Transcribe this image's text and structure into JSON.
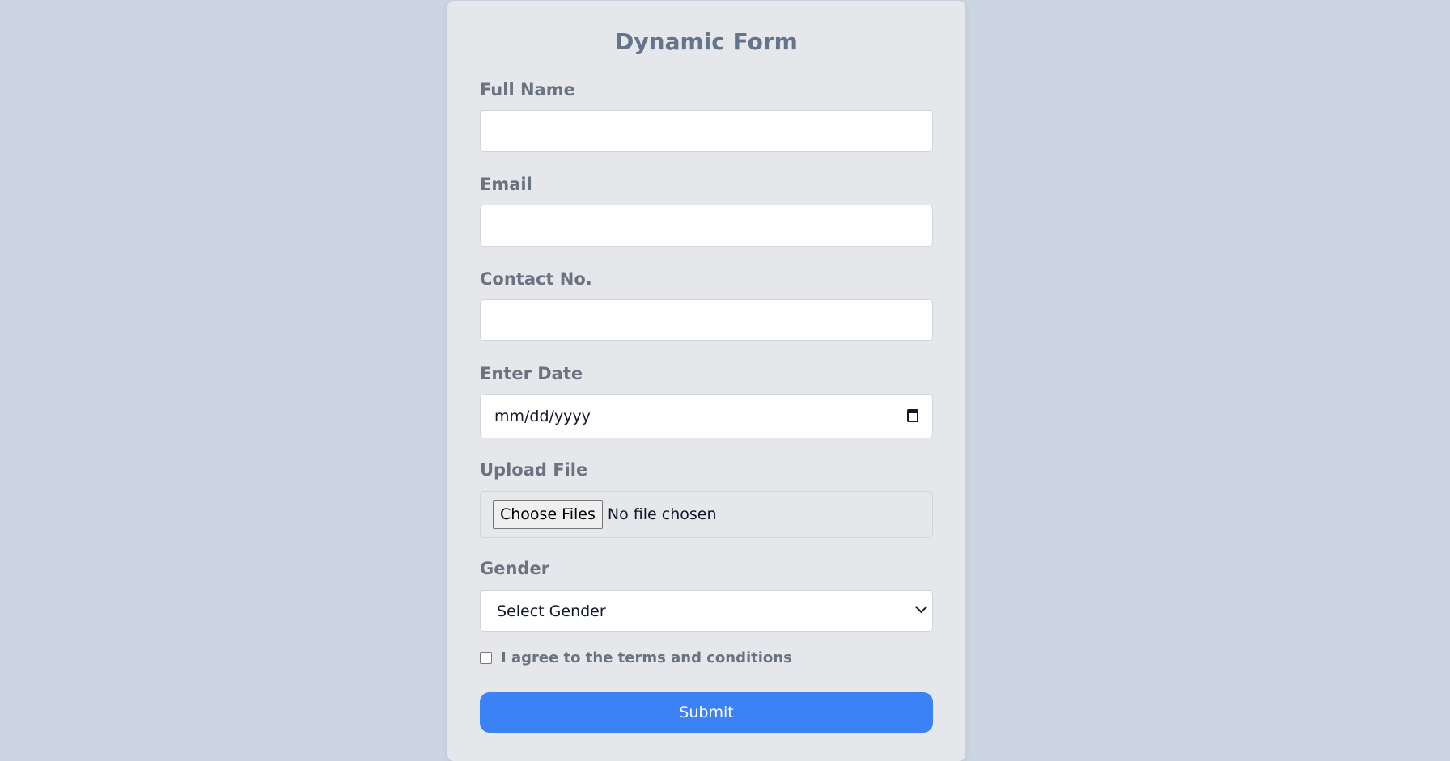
{
  "form": {
    "title": "Dynamic Form",
    "full_name": {
      "label": "Full Name",
      "value": ""
    },
    "email": {
      "label": "Email",
      "value": ""
    },
    "contact": {
      "label": "Contact No.",
      "value": ""
    },
    "date": {
      "label": "Enter Date",
      "placeholder": "mm/dd/yyyy",
      "icon": "calendar-icon"
    },
    "upload": {
      "label": "Upload File",
      "button_label": "Choose Files",
      "status": "No file chosen"
    },
    "gender": {
      "label": "Gender",
      "selected": "Select Gender",
      "icon": "chevron-down-icon"
    },
    "terms": {
      "label": "I agree to the terms and conditions",
      "checked": false
    },
    "submit_label": "Submit"
  },
  "colors": {
    "page_background": "#cbd5e1",
    "card_background": "#e5e7eb",
    "title": "#64748b",
    "label": "#6b7280",
    "submit_button": "#3b82f6"
  }
}
